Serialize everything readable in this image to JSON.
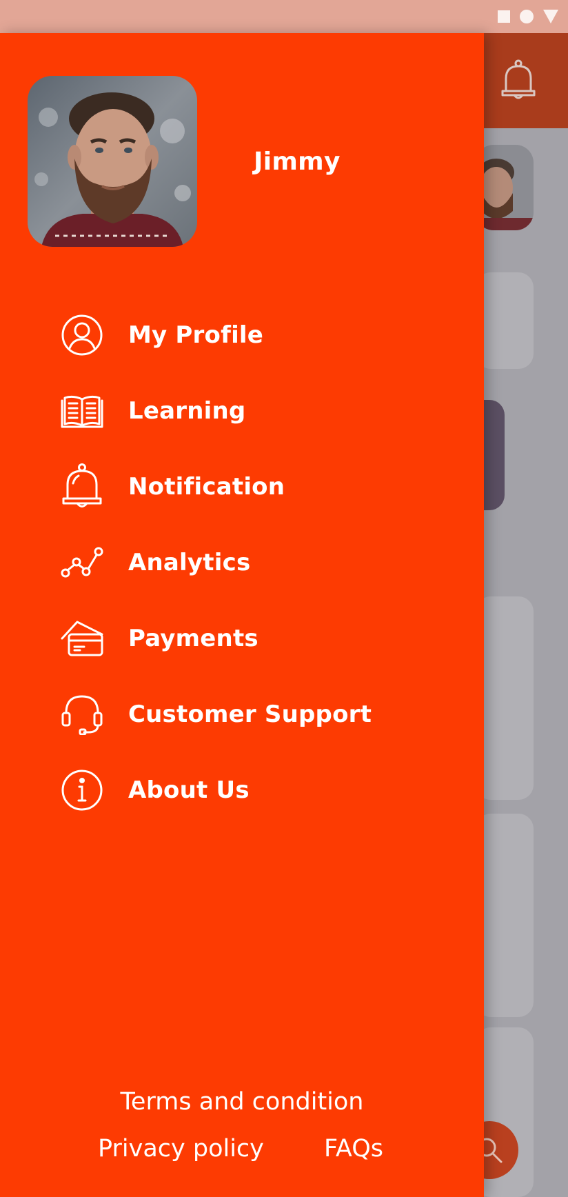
{
  "user": {
    "name": "Jimmy"
  },
  "menu": {
    "items": [
      {
        "label": "My Profile",
        "icon": "user-circle-icon"
      },
      {
        "label": "Learning",
        "icon": "open-book-icon"
      },
      {
        "label": "Notification",
        "icon": "bell-icon"
      },
      {
        "label": "Analytics",
        "icon": "analytics-line-icon"
      },
      {
        "label": "Payments",
        "icon": "credit-card-icon"
      },
      {
        "label": "Customer Support",
        "icon": "headset-icon"
      },
      {
        "label": "About Us",
        "icon": "info-circle-icon"
      }
    ]
  },
  "footer": {
    "terms": "Terms and condition",
    "privacy": "Privacy policy",
    "faqs": "FAQs"
  },
  "colors": {
    "drawer": "#fd3b02",
    "text": "#ffffff",
    "overlay": "#a3a2a8",
    "status_bar": "#e2a696"
  }
}
